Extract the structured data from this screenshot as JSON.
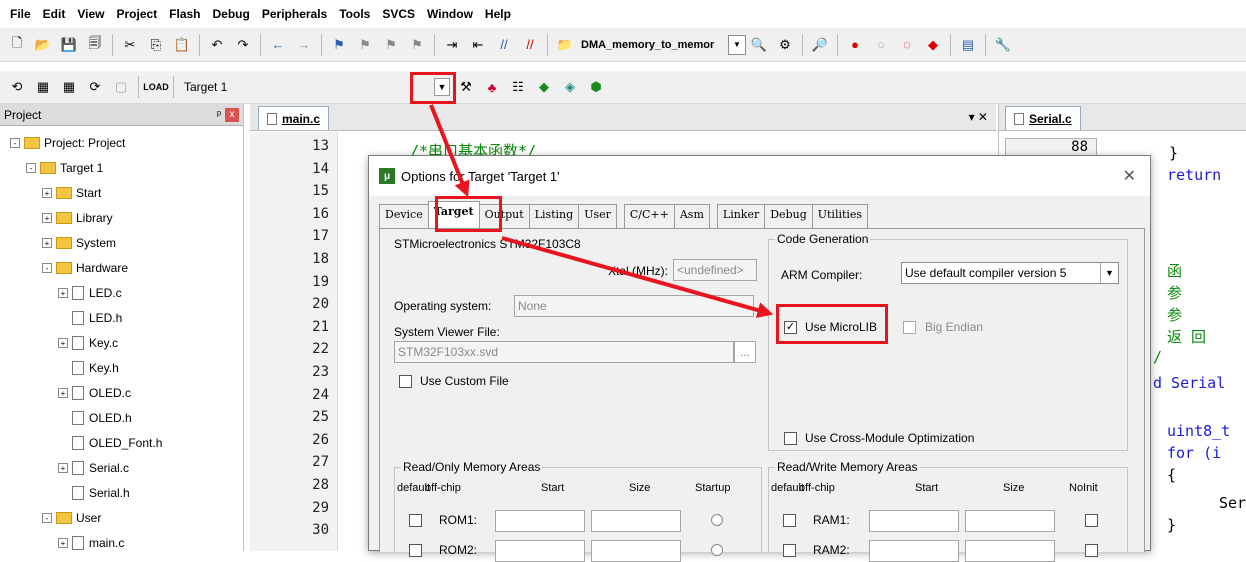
{
  "menu": [
    "File",
    "Edit",
    "View",
    "Project",
    "Flash",
    "Debug",
    "Peripherals",
    "Tools",
    "SVCS",
    "Window",
    "Help"
  ],
  "toolbar": {
    "project_combo": "DMA_memory_to_memor",
    "target_name": "Target 1"
  },
  "project_panel": {
    "title": "Project",
    "pin": "ᵖ",
    "close": "x",
    "tree": [
      {
        "label": "Project: Project",
        "level": 0,
        "kind": "root",
        "toggle": "-"
      },
      {
        "label": "Target 1",
        "level": 1,
        "kind": "target",
        "toggle": "-"
      },
      {
        "label": "Start",
        "level": 2,
        "kind": "folder",
        "toggle": "+"
      },
      {
        "label": "Library",
        "level": 2,
        "kind": "folder",
        "toggle": "+"
      },
      {
        "label": "System",
        "level": 2,
        "kind": "folder",
        "toggle": "+"
      },
      {
        "label": "Hardware",
        "level": 2,
        "kind": "folder",
        "toggle": "-"
      },
      {
        "label": "LED.c",
        "level": 3,
        "kind": "file",
        "toggle": "+"
      },
      {
        "label": "LED.h",
        "level": 3,
        "kind": "file",
        "toggle": ""
      },
      {
        "label": "Key.c",
        "level": 3,
        "kind": "file",
        "toggle": "+"
      },
      {
        "label": "Key.h",
        "level": 3,
        "kind": "file",
        "toggle": ""
      },
      {
        "label": "OLED.c",
        "level": 3,
        "kind": "file",
        "toggle": "+"
      },
      {
        "label": "OLED.h",
        "level": 3,
        "kind": "file",
        "toggle": ""
      },
      {
        "label": "OLED_Font.h",
        "level": 3,
        "kind": "file",
        "toggle": ""
      },
      {
        "label": "Serial.c",
        "level": 3,
        "kind": "file",
        "toggle": "+"
      },
      {
        "label": "Serial.h",
        "level": 3,
        "kind": "file",
        "toggle": ""
      },
      {
        "label": "User",
        "level": 2,
        "kind": "folder",
        "toggle": "-"
      },
      {
        "label": "main.c",
        "level": 3,
        "kind": "file",
        "toggle": "+"
      }
    ]
  },
  "editor": {
    "tab": "main.c",
    "controls": "▾ ✕",
    "line_numbers": [
      "13",
      "14",
      "15",
      "16",
      "17",
      "18",
      "19",
      "20",
      "21",
      "22",
      "23",
      "24",
      "25",
      "26",
      "27",
      "28",
      "29",
      "30"
    ],
    "first_line": "/*串口基本函数*/"
  },
  "editor2": {
    "tab": "Serial.c",
    "line_number": "88",
    "lines": [
      {
        "text": "}",
        "color": "#000000"
      },
      {
        "text": "return",
        "color": "#1a1ad8"
      },
      {
        "text": "函",
        "color": "#0a8a0a"
      },
      {
        "text": "参",
        "color": "#0a8a0a"
      },
      {
        "text": "参",
        "color": "#0a8a0a"
      },
      {
        "text": "返 回",
        "color": "#0a8a0a"
      },
      {
        "text": "/",
        "color": "#0a8a0a"
      },
      {
        "text": "d Serial",
        "color": "#1a1ad8"
      },
      {
        "text": "uint8_t",
        "color": "#1a1ad8"
      },
      {
        "text": "for (i",
        "color": "#1a1ad8"
      },
      {
        "text": "{",
        "color": "#000000"
      },
      {
        "text": "Ser",
        "color": "#000000"
      },
      {
        "text": "}",
        "color": "#000000"
      }
    ]
  },
  "dialog": {
    "title": "Options for Target 'Target 1'",
    "close": "✕",
    "tabs": [
      "Device",
      "Target",
      "Output",
      "Listing",
      "User",
      "C/C++",
      "Asm",
      "Linker",
      "Debug",
      "Utilities"
    ],
    "active_tab": "Target",
    "device_name": "STMicroelectronics STM32F103C8",
    "xtal_label": "Xtal (MHz):",
    "xtal_value": "<undefined>",
    "os_label": "Operating system:",
    "os_value": "None",
    "svd_label": "System Viewer File:",
    "svd_value": "STM32F103xx.svd",
    "browse": "...",
    "use_custom_file": "Use Custom File",
    "code_gen_title": "Code Generation",
    "arm_compiler_label": "ARM Compiler:",
    "arm_compiler_value": "Use default compiler version 5",
    "use_microlib": "Use MicroLIB",
    "use_microlib_checked": true,
    "big_endian": "Big Endian",
    "cross_module": "Use Cross-Module Optimization",
    "ro_title": "Read/Only Memory Areas",
    "rw_title": "Read/Write Memory Areas",
    "ro_headers": [
      "default",
      "off-chip",
      "Start",
      "Size",
      "Startup"
    ],
    "rw_headers": [
      "default",
      "off-chip",
      "Start",
      "Size",
      "NoInit"
    ],
    "ro_rows": [
      "ROM1:",
      "ROM2:"
    ],
    "rw_rows": [
      "RAM1:",
      "RAM2:"
    ]
  },
  "colors": {
    "highlight": "#e8141e",
    "arrow": "#e8141e"
  }
}
